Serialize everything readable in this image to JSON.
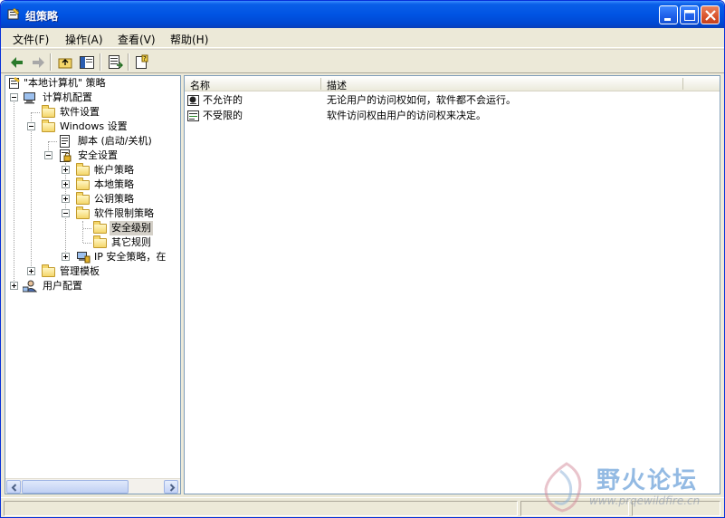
{
  "window": {
    "title": "组策略",
    "title_icon": "group-policy-icon",
    "controls": [
      "minimize-icon",
      "maximize-icon",
      "close-icon"
    ]
  },
  "menu": {
    "items": [
      "文件(F)",
      "操作(A)",
      "查看(V)",
      "帮助(H)"
    ]
  },
  "toolbar": {
    "buttons": [
      "back-arrow-icon",
      "forward-arrow-icon",
      "up-folder-icon",
      "show-hide-tree-icon",
      "export-list-icon",
      "help-icon"
    ]
  },
  "tree": {
    "root": "\"本地计算机\" 策略",
    "computer_config": "计算机配置",
    "software_settings": "软件设置",
    "windows_settings": "Windows 设置",
    "scripts": "脚本 (启动/关机)",
    "security_settings": "安全设置",
    "account_policies": "帐户策略",
    "local_policies": "本地策略",
    "public_key_policies": "公钥策略",
    "software_restriction": "软件限制策略",
    "security_levels": "安全级别",
    "additional_rules": "其它规则",
    "ip_security": "IP 安全策略，在",
    "admin_templates": "管理模板",
    "user_config": "用户配置"
  },
  "list": {
    "columns": [
      "名称",
      "描述"
    ],
    "rows": [
      {
        "name": "不允许的",
        "desc": "无论用户的访问权如何，软件都不会运行。",
        "icon": "disallowed-level-icon"
      },
      {
        "name": "不受限的",
        "desc": "软件访问权由用户的访问权来决定。",
        "icon": "unrestricted-level-icon"
      }
    ]
  },
  "watermark": {
    "text": "野火论坛",
    "url": "www.prqewildfire.cn"
  },
  "colors": {
    "title_bar": "#0054e3",
    "chrome": "#ece9d8",
    "pane_border": "#7f9db9",
    "watermark": "#2a78c8"
  }
}
